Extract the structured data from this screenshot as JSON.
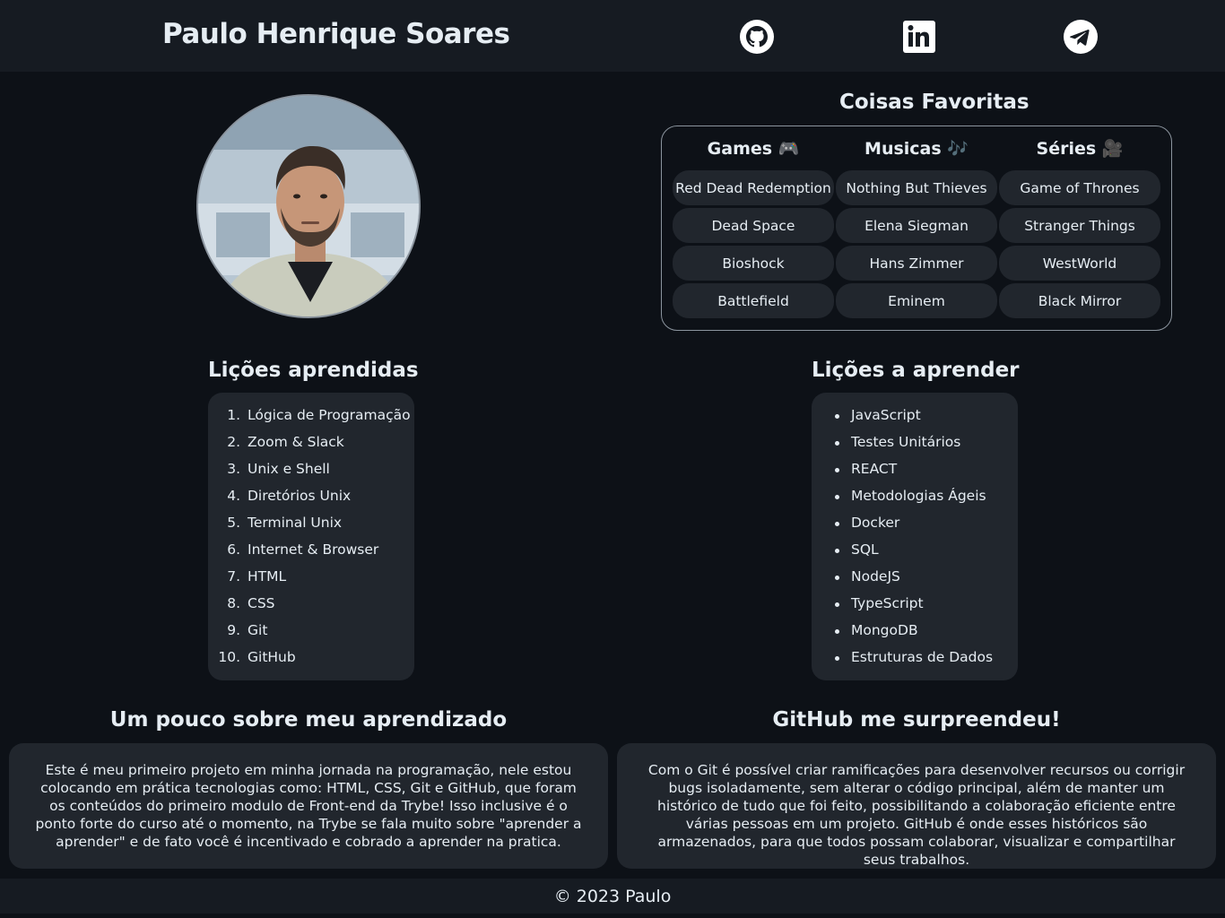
{
  "header": {
    "title": "Paulo Henrique Soares",
    "social_links": [
      {
        "icon": "github-icon"
      },
      {
        "icon": "linkedin-icon"
      },
      {
        "icon": "telegram-icon"
      }
    ]
  },
  "favorites": {
    "title": "Coisas Favoritas",
    "columns": [
      {
        "heading": "Games 🎮",
        "items": [
          "Red Dead Redemption",
          "Dead Space",
          "Bioshock",
          "Battlefield"
        ]
      },
      {
        "heading": "Musicas 🎶",
        "items": [
          "Nothing But Thieves",
          "Elena Siegman",
          "Hans Zimmer",
          "Eminem"
        ]
      },
      {
        "heading": "Séries 🎥",
        "items": [
          "Game of Thrones",
          "Stranger Things",
          "WestWorld",
          "Black Mirror"
        ]
      }
    ]
  },
  "learned": {
    "title": "Lições aprendidas",
    "numbers": [
      "1.",
      "2.",
      "3.",
      "4.",
      "5.",
      "6.",
      "7.",
      "8.",
      "9.",
      "10."
    ],
    "items": [
      "Lógica de Programação",
      "Zoom & Slack",
      "Unix e Shell",
      "Diretórios Unix",
      "Terminal Unix",
      "Internet & Browser",
      "HTML",
      "CSS",
      "Git",
      "GitHub"
    ]
  },
  "to_learn": {
    "title": "Lições a aprender",
    "items": [
      "JavaScript",
      "Testes Unitários",
      "REACT",
      "Metodologias Ágeis",
      "Docker",
      "SQL",
      "NodeJS",
      "TypeScript",
      "MongoDB",
      "Estruturas de Dados"
    ]
  },
  "about": {
    "title": "Um pouco sobre meu aprendizado",
    "text": "Este é meu primeiro projeto em minha jornada na programação, nele estou colocando em prática tecnologias como: HTML, CSS, Git e GitHub, que foram os conteúdos do primeiro modulo de Front-end da Trybe! Isso inclusive é o ponto forte do curso até o momento, na Trybe se fala muito sobre \"aprender a aprender\" e de fato você é incentivado e cobrado a aprender na pratica."
  },
  "github": {
    "title": "GitHub me surpreendeu!",
    "text": "Com o Git é possível criar ramificações para desenvolver recursos ou corrigir bugs isoladamente, sem alterar o código principal, além de manter um histórico de tudo que foi feito, possibilitando a colaboração eficiente entre várias pessoas em um projeto. GitHub é onde esses históricos são armazenados, para que todos possam colaborar, visualizar e compartilhar seus trabalhos."
  },
  "footer": {
    "text": "© 2023 Paulo"
  }
}
